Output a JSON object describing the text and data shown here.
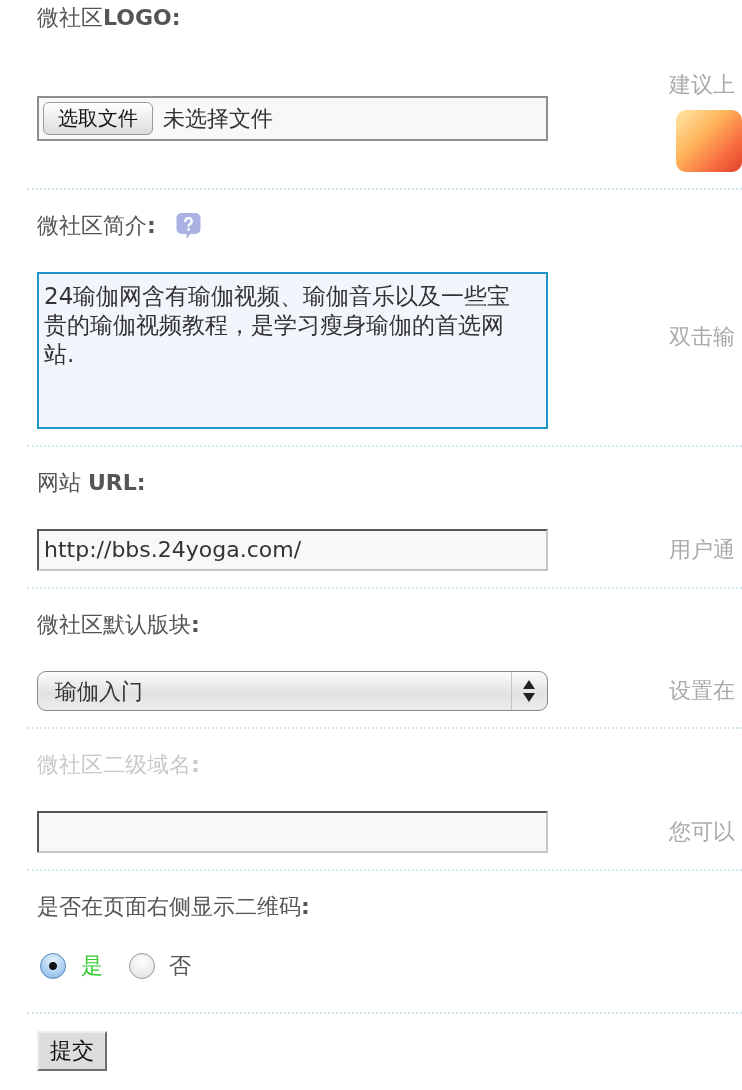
{
  "fields": [
    {
      "kind": "file",
      "label": "微社区**LOGO:**",
      "button": "选取文件",
      "status": "未选择文件",
      "hint": "建议上",
      "preview_image": true,
      "disabled": false,
      "focused": false
    },
    {
      "kind": "textarea",
      "label": "微社区简介**:**",
      "help_icon": true,
      "value": "24瑜伽网含有瑜伽视频、瑜伽音乐以及一些宝贵的瑜伽视频教程，是学习瘦身瑜伽的首选网站.",
      "hint": "双击输",
      "disabled": false,
      "focused": true
    },
    {
      "kind": "text",
      "label": "网站 **URL:**",
      "value": "http://bbs.24yoga.com/",
      "hint": "用户通",
      "disabled": false,
      "focused": false
    },
    {
      "kind": "select",
      "label": "微社区默认版块**:**",
      "value": "瑜伽入门",
      "hint": "设置在",
      "disabled": false,
      "focused": false
    },
    {
      "kind": "text",
      "label": "微社区二级域名**:**",
      "hint": "您可以",
      "disabled": true,
      "focused": false
    },
    {
      "kind": "radio",
      "label": "是否在页面右侧显示二维码**:**",
      "disabled": false,
      "options": [
        {
          "label": "是",
          "selected": true
        },
        {
          "label": "否",
          "selected": false
        }
      ]
    }
  ],
  "submit_button": "提交"
}
